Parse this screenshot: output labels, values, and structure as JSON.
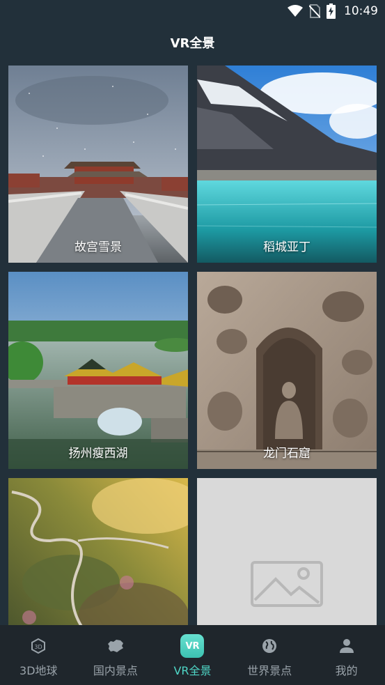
{
  "status_bar": {
    "time": "10:49",
    "icons": [
      "wifi-icon",
      "no-sim-icon",
      "battery-charging-icon"
    ]
  },
  "header": {
    "title": "VR全景"
  },
  "scenic_spots": [
    {
      "label": "故宫雪景",
      "image": "forbidden-city-snow"
    },
    {
      "label": "稻城亚丁",
      "image": "daocheng-yading-lake"
    },
    {
      "label": "扬州瘦西湖",
      "image": "yangzhou-slender-west-lake"
    },
    {
      "label": "龙门石窟",
      "image": "longmen-grottoes"
    },
    {
      "label": "",
      "image": "mountain-road-aerial"
    },
    {
      "label": "",
      "image": "image-placeholder-icon"
    }
  ],
  "bottom_nav": {
    "items": [
      {
        "label": "3D地球",
        "icon": "cube-3d-icon",
        "active": false
      },
      {
        "label": "国内景点",
        "icon": "china-map-icon",
        "active": false
      },
      {
        "label": "VR全景",
        "icon": "vr-icon",
        "icon_text": "VR",
        "active": true
      },
      {
        "label": "世界景点",
        "icon": "globe-icon",
        "active": false
      },
      {
        "label": "我的",
        "icon": "user-icon",
        "active": false
      }
    ]
  },
  "colors": {
    "background": "#22303a",
    "nav_background": "#1f262c",
    "accent": "#4fd6c6",
    "inactive": "#9aa3aa"
  }
}
